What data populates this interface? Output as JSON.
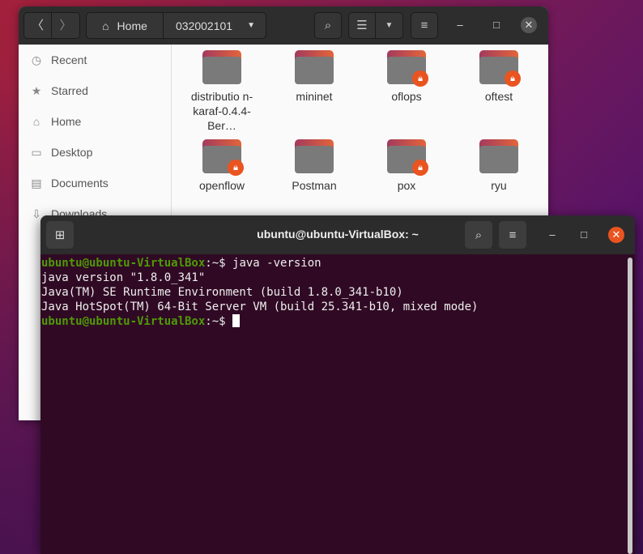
{
  "files_window": {
    "path": {
      "home_label": "Home",
      "current": "032002101"
    },
    "sidebar": [
      {
        "label": "Recent",
        "icon": "clock-icon"
      },
      {
        "label": "Starred",
        "icon": "star-icon"
      },
      {
        "label": "Home",
        "icon": "home-icon"
      },
      {
        "label": "Desktop",
        "icon": "desktop-icon"
      },
      {
        "label": "Documents",
        "icon": "document-icon"
      },
      {
        "label": "Downloads",
        "icon": "download-icon"
      }
    ],
    "files": [
      {
        "name": "distributio n-karaf-0.4.4-Ber…",
        "locked": false
      },
      {
        "name": "mininet",
        "locked": false
      },
      {
        "name": "oflops",
        "locked": true
      },
      {
        "name": "oftest",
        "locked": true
      },
      {
        "name": "openflow",
        "locked": true
      },
      {
        "name": "Postman",
        "locked": false
      },
      {
        "name": "pox",
        "locked": true
      },
      {
        "name": "ryu",
        "locked": false
      }
    ]
  },
  "terminal": {
    "title": "ubuntu@ubuntu-VirtualBox: ~",
    "prompt_user": "ubuntu@ubuntu-VirtualBox",
    "prompt_sep": ":~$ ",
    "command": "java -version",
    "output": [
      "java version \"1.8.0_341\"",
      "Java(TM) SE Runtime Environment (build 1.8.0_341-b10)",
      "Java HotSpot(TM) 64-Bit Server VM (build 25.341-b10, mixed mode)"
    ]
  }
}
